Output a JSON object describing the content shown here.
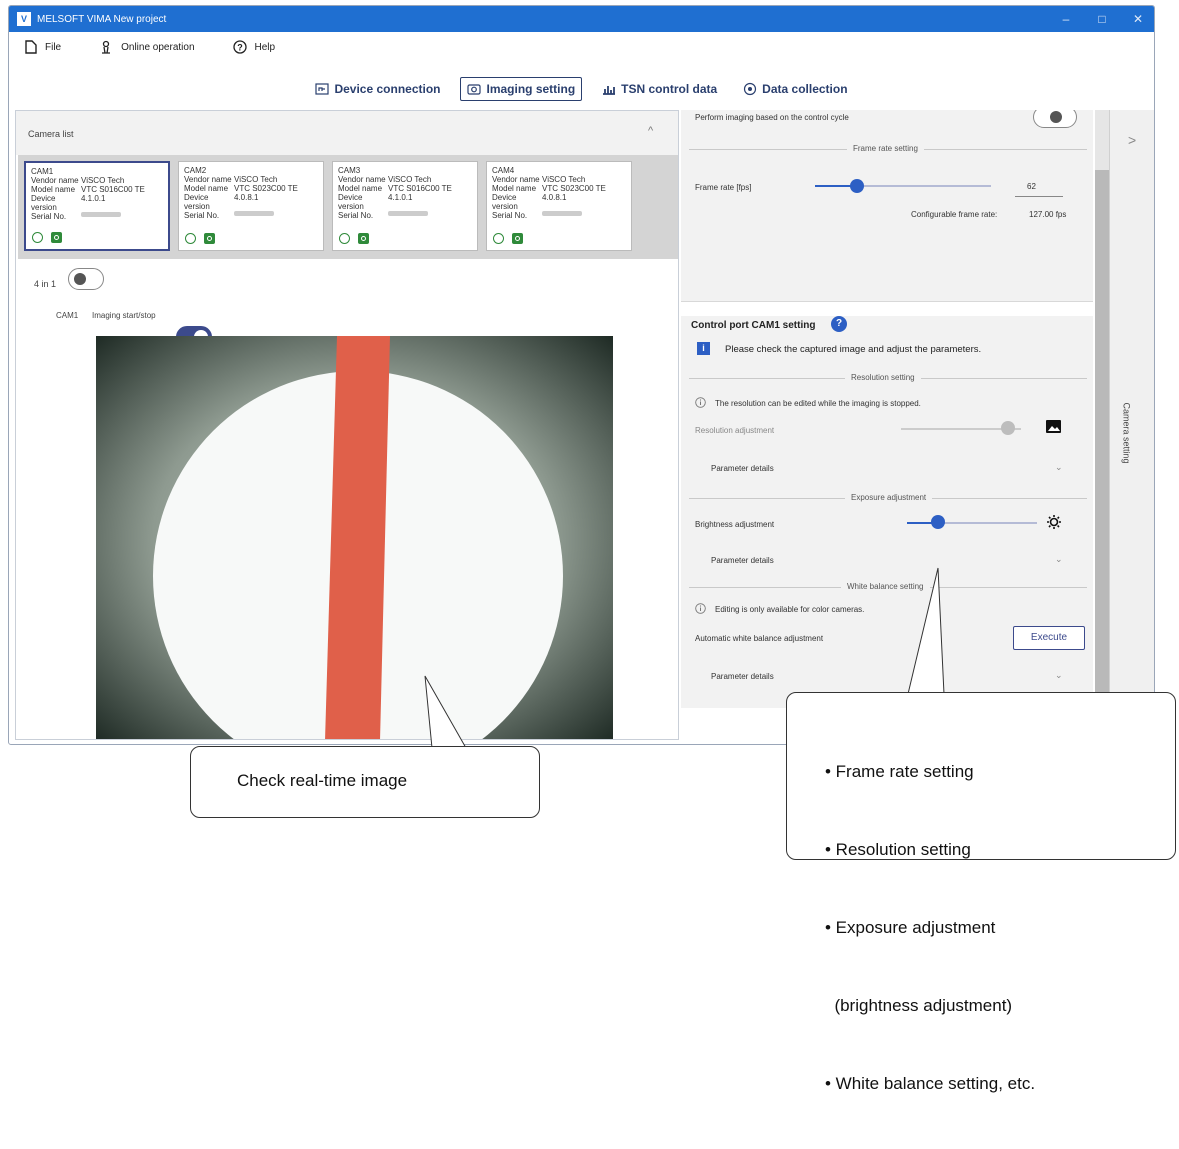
{
  "window": {
    "title": "MELSOFT VIMA New project",
    "logo_text": "V",
    "minimize": "–",
    "maximize": "□",
    "close": "✕"
  },
  "menu": {
    "file": "File",
    "online": "Online operation",
    "help": "Help"
  },
  "tabs": {
    "device": "Device connection",
    "imaging": "Imaging setting",
    "tsn": "TSN control data",
    "collection": "Data collection"
  },
  "camera_list": {
    "title": "Camera list",
    "collapse": "^",
    "cameras": [
      {
        "name": "CAM1",
        "vendor_label": "Vendor name",
        "vendor": "ViSCO Tech",
        "model_label": "Model name",
        "model": "VTC S016C00 TE",
        "dev_label": "Device version",
        "dev": "4.1.0.1",
        "serial_label": "Serial No."
      },
      {
        "name": "CAM2",
        "vendor_label": "Vendor name",
        "vendor": "ViSCO Tech",
        "model_label": "Model name",
        "model": "VTC S023C00 TE",
        "dev_label": "Device version",
        "dev": "4.0.8.1",
        "serial_label": "Serial No."
      },
      {
        "name": "CAM3",
        "vendor_label": "Vendor name",
        "vendor": "ViSCO Tech",
        "model_label": "Model name",
        "model": "VTC S016C00 TE",
        "dev_label": "Device version",
        "dev": "4.1.0.1",
        "serial_label": "Serial No."
      },
      {
        "name": "CAM4",
        "vendor_label": "Vendor name",
        "vendor": "ViSCO Tech",
        "model_label": "Model name",
        "model": "VTC S023C00 TE",
        "dev_label": "Device version",
        "dev": "4.0.8.1",
        "serial_label": "Serial No."
      }
    ]
  },
  "view": {
    "four_in_one": "4 in 1",
    "four_in_one_on": false,
    "cam": "CAM1",
    "imaging_label": "Imaging start/stop",
    "imaging_on": true
  },
  "settings_top": {
    "control_cycle": "Perform imaging based on the control cycle",
    "frame_rate_section": "Frame rate setting",
    "frame_rate_label": "Frame rate [fps]",
    "frame_rate_value": "62",
    "configurable_label": "Configurable frame rate:",
    "configurable_value": "127.00 fps"
  },
  "control": {
    "title": "Control port CAM1 setting",
    "help": "?",
    "info_icon": "i",
    "info_text": "Please check the captured image and adjust the parameters.",
    "resolution_section": "Resolution setting",
    "resolution_note": "The resolution can be edited while the imaging is stopped.",
    "resolution_label": "Resolution adjustment",
    "param1": "Parameter details",
    "exposure_section": "Exposure adjustment",
    "brightness_label": "Brightness adjustment",
    "param2": "Parameter details",
    "wb_section": "White balance setting",
    "wb_note": "Editing is only available for color cameras.",
    "wb_label": "Automatic white balance adjustment",
    "execute": "Execute",
    "param3": "Parameter details"
  },
  "drawer": {
    "label": "Camera setting",
    "arrow": ">"
  },
  "callouts": {
    "left": "Check real-time image",
    "right": [
      "• Frame rate setting",
      "• Resolution setting",
      "• Exposure adjustment",
      "  (brightness adjustment)",
      "• White balance setting, etc."
    ]
  },
  "colors": {
    "titlebar": "#1f6fd1",
    "accent": "#3c4a8c",
    "slider": "#2d5fc4",
    "camera_icon": "#2f8a3a",
    "strip": "#e0604a"
  }
}
